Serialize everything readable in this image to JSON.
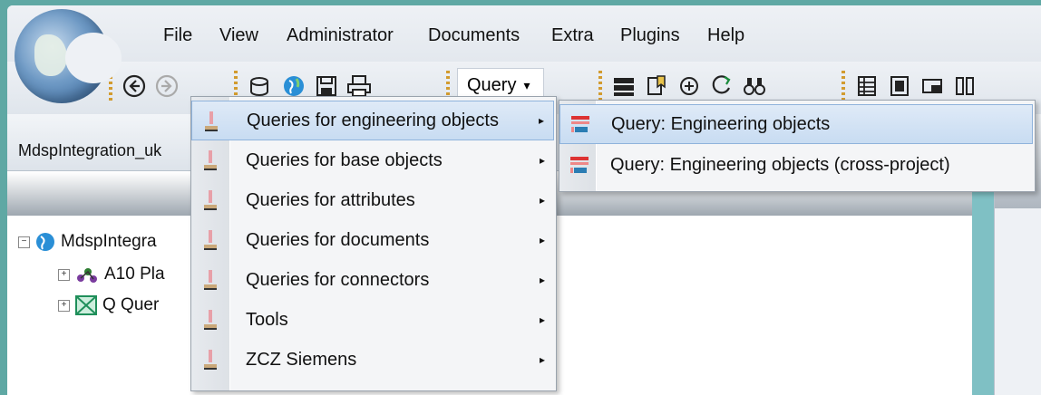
{
  "menubar": {
    "items": [
      "File",
      "View",
      "Administrator",
      "Documents",
      "Extra",
      "Plugins",
      "Help"
    ]
  },
  "toolbar": {
    "query_dropdown_label": "Query",
    "query_dropdown_arrow": "▾",
    "back_icon": "◀",
    "forward_icon": "▶"
  },
  "project_pane": {
    "title": "MdspIntegration_uk",
    "tree": [
      {
        "expander": "⊟",
        "label": "MdspIntegra"
      },
      {
        "expander": "⊞",
        "label": "A10  Pla"
      },
      {
        "expander": "⊞",
        "label": "Q   Quer"
      }
    ]
  },
  "query_menu": {
    "items": [
      {
        "label": "Queries for engineering objects",
        "arrow": "▸"
      },
      {
        "label": "Queries for base objects",
        "arrow": "▸"
      },
      {
        "label": "Queries for attributes",
        "arrow": "▸"
      },
      {
        "label": "Queries for documents",
        "arrow": "▸"
      },
      {
        "label": "Queries for connectors",
        "arrow": "▸"
      },
      {
        "label": "Tools",
        "arrow": "▸"
      },
      {
        "label": "ZCZ Siemens",
        "arrow": "▸"
      }
    ]
  },
  "submenu": {
    "items": [
      {
        "label": "Query: Engineering objects"
      },
      {
        "label": "Query: Engineering objects (cross-project)"
      }
    ]
  },
  "colors": {
    "highlight": "#c8dcf2",
    "highlight_border": "#8fb3dc",
    "accent_teal": "#5fa8a4"
  }
}
